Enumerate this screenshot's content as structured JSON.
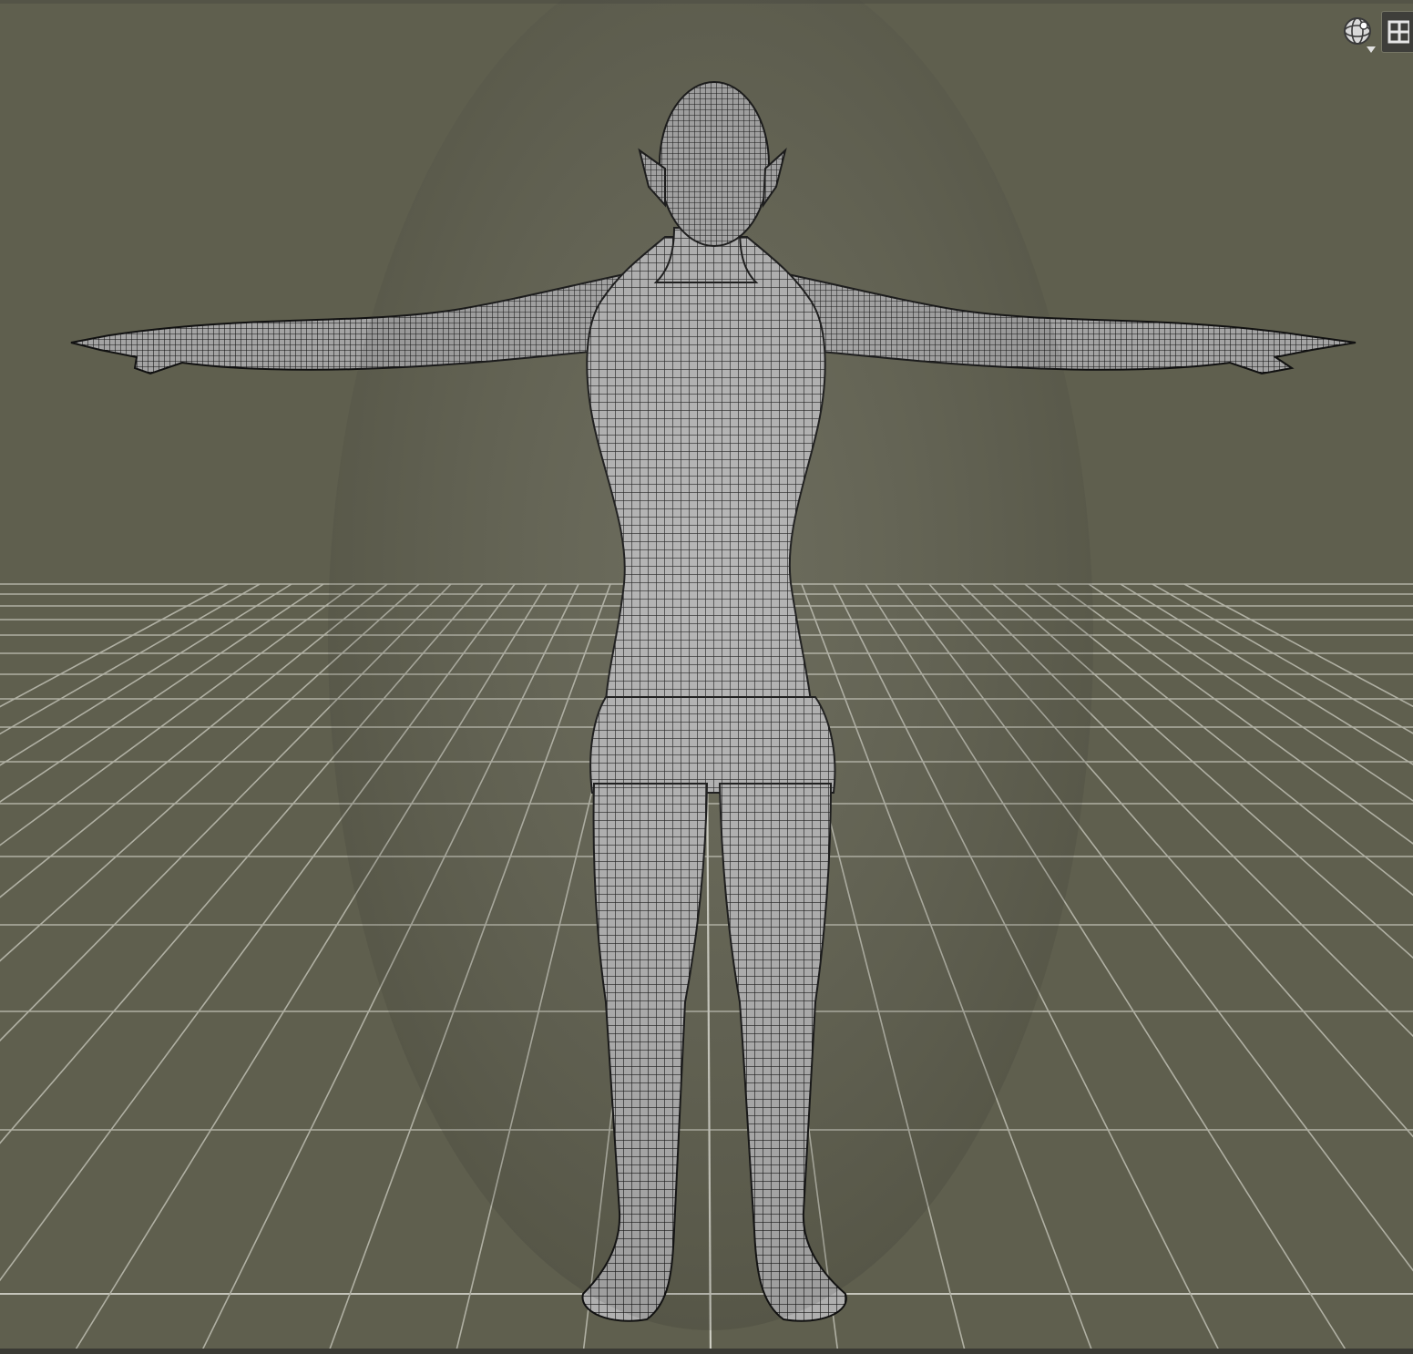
{
  "viewport": {
    "name": "3D Viewport",
    "background_color": "#5f5f4e",
    "grid_color": "#b9b9ad",
    "mesh_fill_color": "#a9a9a9",
    "wire_color": "#111111"
  },
  "toolbar": {
    "buttons": [
      {
        "name": "camera-orbit-icon",
        "has_dropdown": true
      },
      {
        "name": "viewport-layout-icon",
        "has_dropdown": false
      }
    ]
  },
  "scene": {
    "model": "human-figure-tpose-wireframe",
    "display_mode": "wireframe-on-shaded"
  }
}
